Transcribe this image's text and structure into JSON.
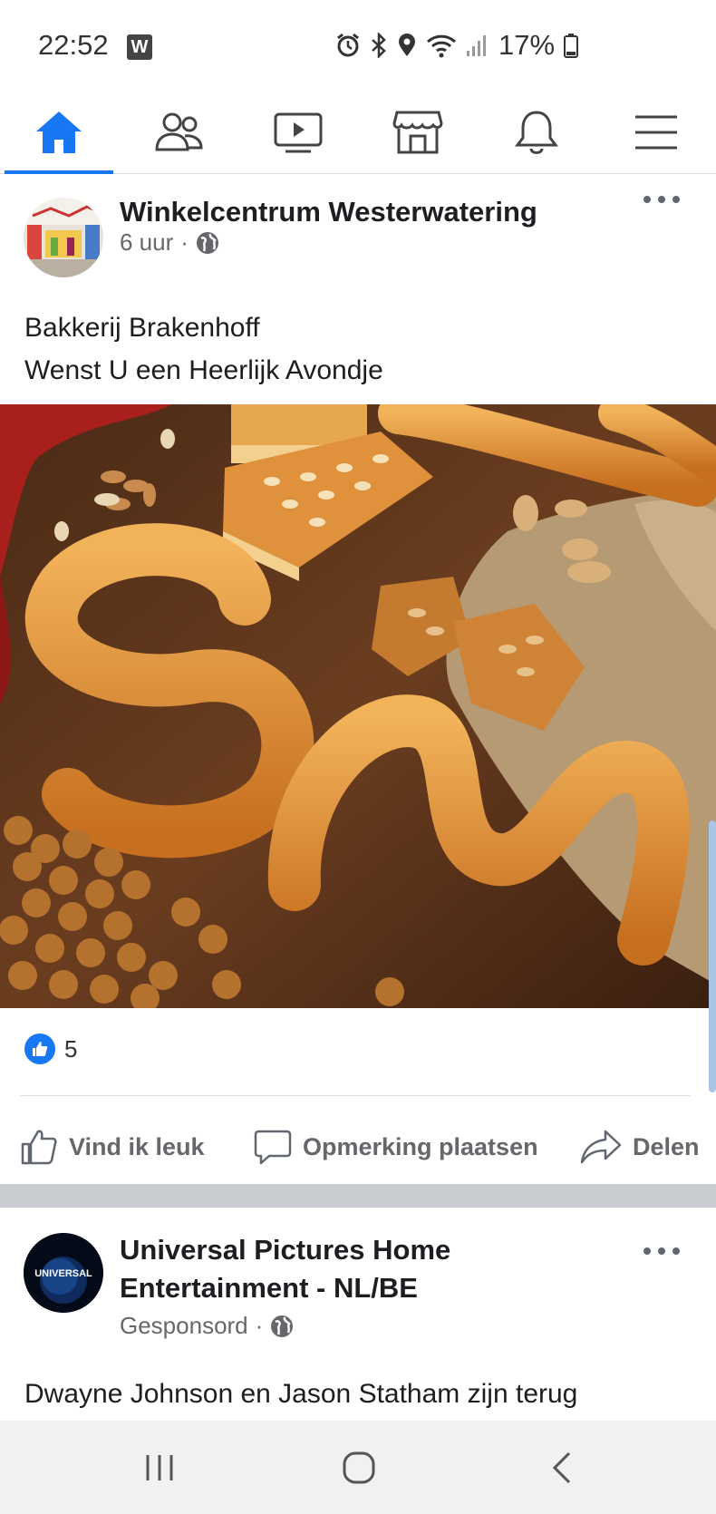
{
  "status_bar": {
    "time": "22:52",
    "app_badge": "W",
    "battery": "17%",
    "icons": [
      "alarm-icon",
      "bluetooth-icon",
      "location-icon",
      "wifi-icon",
      "signal-icon",
      "battery-icon"
    ]
  },
  "nav": {
    "tabs": [
      {
        "name": "home",
        "icon": "home-icon",
        "active": true
      },
      {
        "name": "friends",
        "icon": "friends-icon",
        "active": false
      },
      {
        "name": "watch",
        "icon": "video-icon",
        "active": false
      },
      {
        "name": "marketplace",
        "icon": "marketplace-icon",
        "active": false
      },
      {
        "name": "notifications",
        "icon": "bell-icon",
        "active": false
      },
      {
        "name": "menu",
        "icon": "hamburger-menu-icon",
        "active": false
      }
    ],
    "accent_color": "#1877f2"
  },
  "post1": {
    "author": "Winkelcentrum Westerwatering",
    "time": "6 uur",
    "privacy_icon": "globe-icon",
    "text_line1": "Bakkerij Brakenhoff",
    "text_line2": "Wenst U een Heerlijk Avondje",
    "like_count": "5",
    "actions": {
      "like": "Vind ik leuk",
      "comment": "Opmerking plaatsen",
      "share": "Delen"
    }
  },
  "post2": {
    "author_line1": "Universal Pictures Home",
    "author_line2": "Entertainment - NL/BE",
    "avatar_text": "UNIVERSAL",
    "sponsored": "Gesponsord",
    "text": "Dwayne Johnson en Jason Statham zijn terug"
  },
  "system_nav": [
    "recents-icon",
    "home-circle-icon",
    "back-icon"
  ]
}
